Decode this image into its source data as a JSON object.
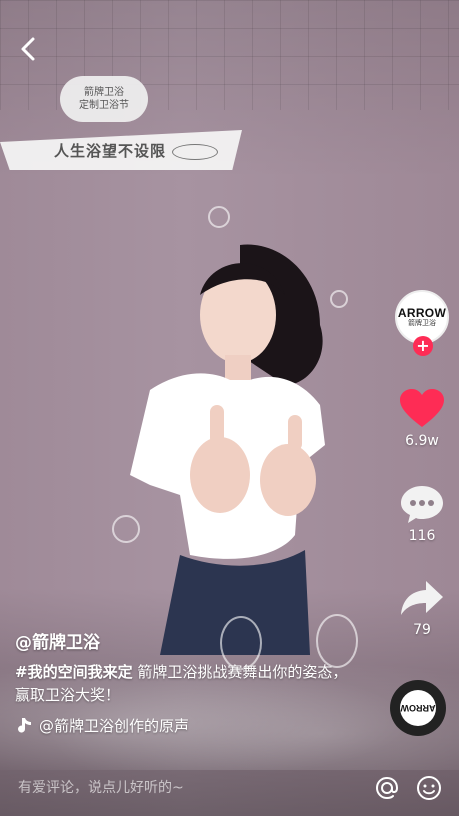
{
  "campaign": {
    "badge_line1": "箭牌卫浴",
    "badge_line2": "定制卫浴节",
    "slogan": "人生浴望不设限"
  },
  "creator": {
    "avatar_brand": "ARROW",
    "avatar_sub": "箭牌卫浴",
    "follow_symbol": "+",
    "username": "@箭牌卫浴"
  },
  "actions": {
    "likes": "6.9w",
    "comments": "116",
    "shares": "79"
  },
  "caption": {
    "hashtag": "#我的空间我来定",
    "text": " 箭牌卫浴挑战赛舞出你的姿态，赢取卫浴大奖！"
  },
  "music": {
    "title": "@箭牌卫浴创作的原声"
  },
  "disc": {
    "label": "ARROW"
  },
  "comment_bar": {
    "placeholder": "有爱评论，说点儿好听的~"
  },
  "colors": {
    "like": "#fe2c55",
    "follow": "#fe2c55",
    "wall": "#a793a1"
  },
  "icons": [
    "back-arrow-icon",
    "heart-icon",
    "comment-icon",
    "share-icon",
    "music-note-icon",
    "at-icon",
    "emoji-icon",
    "smile-icon"
  ]
}
